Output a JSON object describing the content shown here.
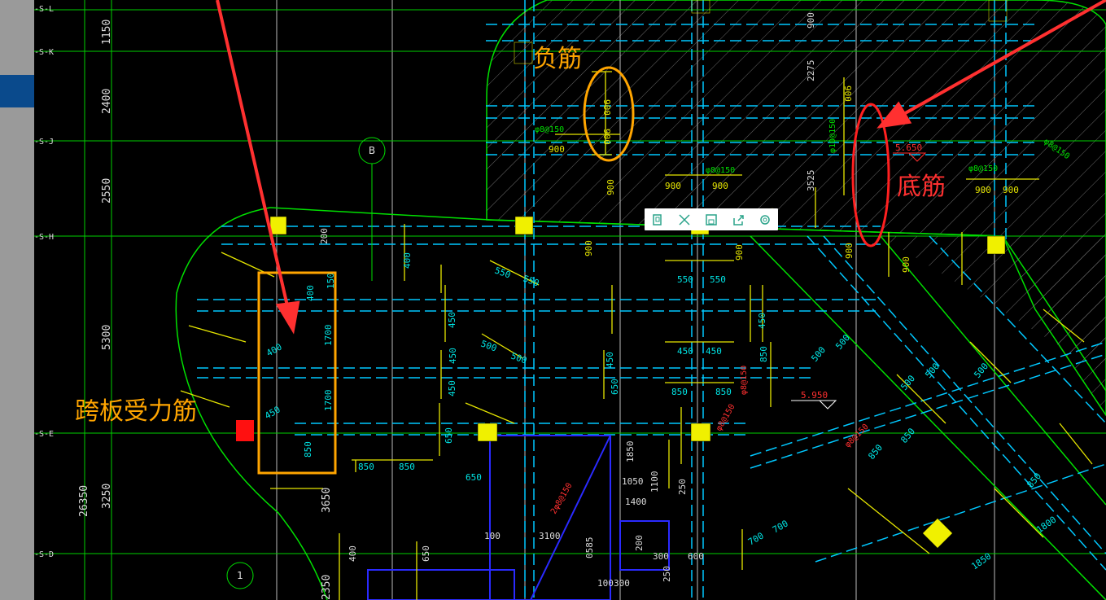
{
  "grid_labels": [
    "-S-L",
    "-S-K",
    "-S-J",
    "-S-H",
    "-S-E",
    "-S-D"
  ],
  "axis_bubble": "B",
  "axis_bubble_2": "1",
  "left_dims": [
    "1150",
    "2400",
    "2550",
    "5300",
    "3250",
    "26350",
    "3650",
    "2350"
  ],
  "top_dims": [
    "900",
    "2275",
    "3525",
    "200"
  ],
  "dims_top_area": [
    "900",
    "900",
    "900",
    "900",
    "900",
    "900",
    "900",
    "900",
    "900",
    "900",
    "900",
    "900",
    "900",
    "900"
  ],
  "dims_mid": [
    "550",
    "550",
    "550",
    "550",
    "400",
    "450",
    "450",
    "450",
    "450",
    "450",
    "450",
    "450",
    "650",
    "650",
    "500",
    "500",
    "850",
    "850",
    "850",
    "850",
    "850",
    "650",
    "1700",
    "1700",
    "150",
    "400",
    "400",
    "450"
  ],
  "dims_right": [
    "500",
    "500",
    "500",
    "500",
    "500",
    "850",
    "850",
    "850",
    "850",
    "1800",
    "1850",
    "700",
    "700"
  ],
  "dims_lower": [
    "1850",
    "1050",
    "1100",
    "1400",
    "200",
    "300",
    "600",
    "250",
    "100",
    "3100",
    "0585",
    "100",
    "300",
    "250",
    "650",
    "400"
  ],
  "rebar_labels": [
    "φ8@150",
    "φ8@150",
    "φ10@150",
    "φ8@150",
    "φ8@150",
    "φ8@150",
    "φ8@150",
    "φ8@150",
    "2φ8@150"
  ],
  "elevations": [
    "5.650",
    "5.950"
  ],
  "annotations": {
    "fujin": "负筋",
    "dijin": "底筋",
    "kuaban": "跨板受力筋"
  },
  "toolbar": {
    "icons": [
      "copy-icon",
      "fullscreen-icon",
      "save-icon",
      "share-icon",
      "settings-icon"
    ]
  },
  "colors": {
    "background": "#000000",
    "grid_white": "#c8c8c8",
    "axis_green": "#00e000",
    "rebar_yellow": "#e6e600",
    "dim_cyan": "#00e6e6",
    "beam_cyan": "#00c8ff",
    "wall_blue": "#3030ff",
    "rebar_red": "#ff2020",
    "arrow_red": "#ff3030",
    "anno_orange": "#ffa500"
  }
}
